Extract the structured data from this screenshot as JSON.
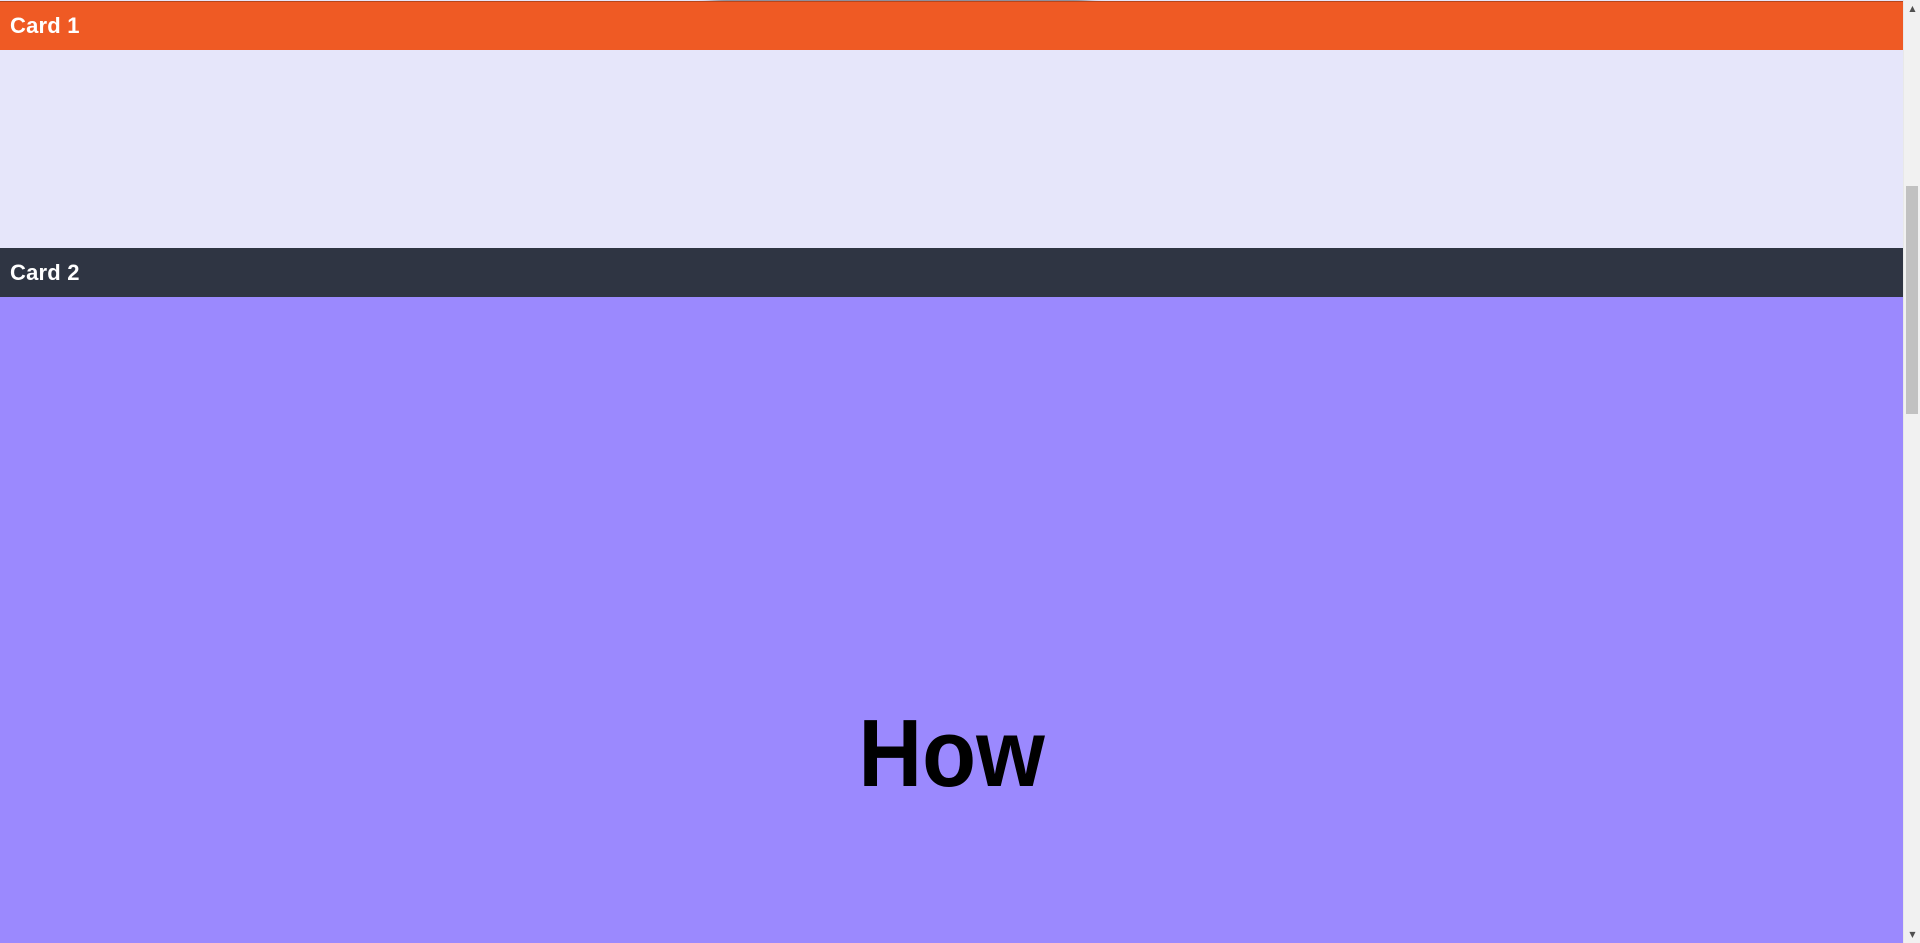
{
  "cards": [
    {
      "title": "Card 1",
      "header_color": "#ef5a24",
      "body_color": "#e6e6fa"
    },
    {
      "title": "Card 2",
      "header_color": "#2f3543",
      "body_color": "#9b89fe",
      "headline": "How"
    }
  ],
  "scrollbar": {
    "up_icon": "▲",
    "down_icon": "▼"
  }
}
